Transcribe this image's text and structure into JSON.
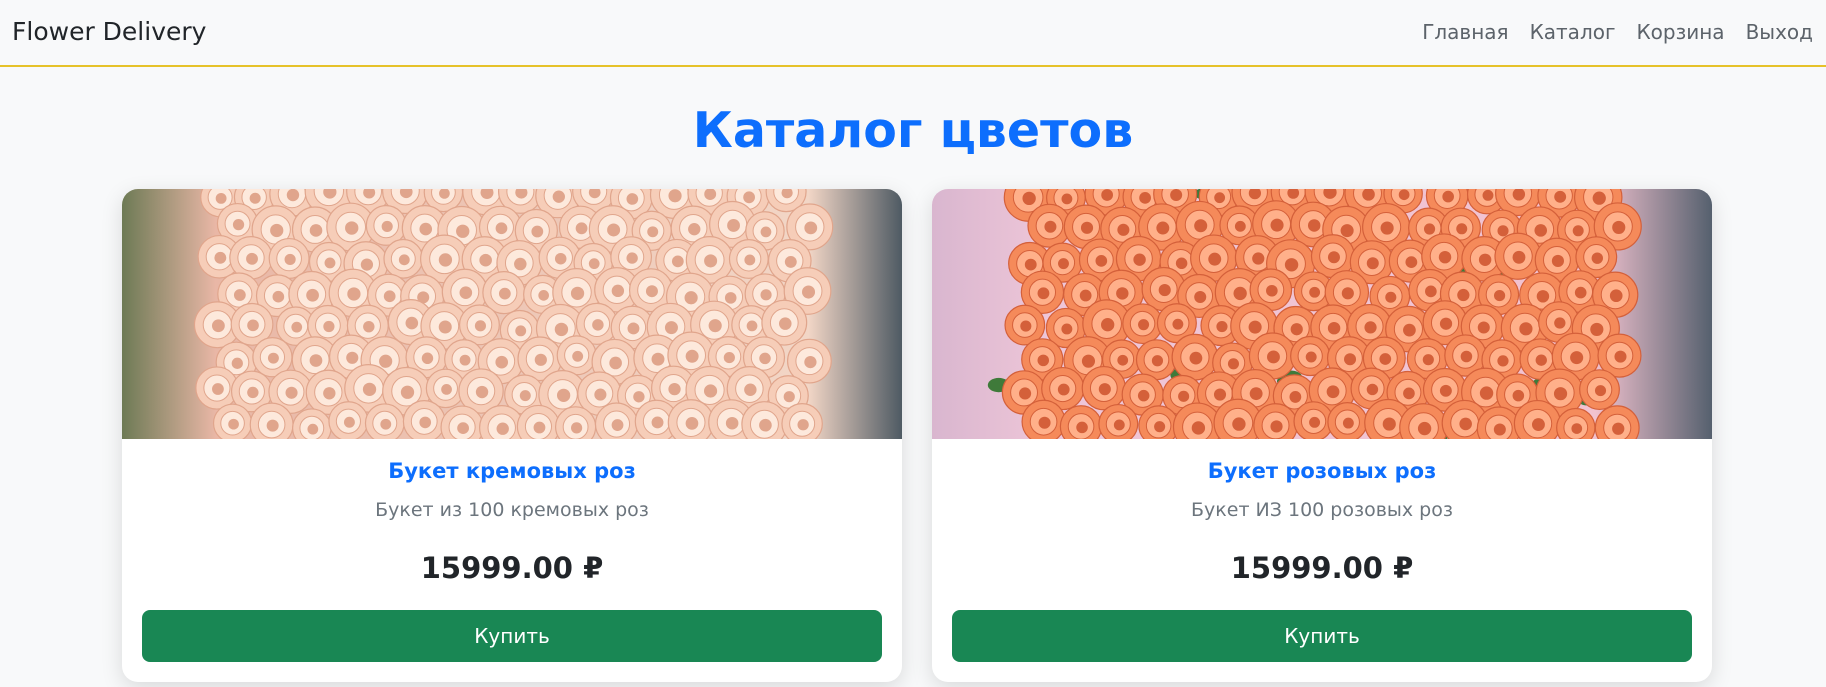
{
  "navbar": {
    "brand": "Flower Delivery",
    "links": [
      "Главная",
      "Каталог",
      "Корзина",
      "Выход"
    ]
  },
  "page": {
    "title": "Каталог цветов"
  },
  "products": [
    {
      "title": "Букет кремовых роз",
      "description": "Букет из 100 кремовых роз",
      "price": "15999.00 ₽",
      "buy_label": "Купить",
      "image": "cream-roses-bouquet-image",
      "colors": {
        "petal": "#f6cdb8",
        "petal_light": "#fde9dc",
        "petal_dark": "#e0a58c"
      }
    },
    {
      "title": "Букет розовых роз",
      "description": "Букет ИЗ 100 розовых роз",
      "price": "15999.00 ₽",
      "buy_label": "Купить",
      "image": "coral-roses-bouquet-image",
      "colors": {
        "petal": "#f58a5a",
        "petal_light": "#ffb08a",
        "petal_dark": "#d4603a"
      }
    }
  ],
  "theme": {
    "accent": "#0d6efd",
    "button": "#198754",
    "nav_border": "#e6c229"
  }
}
